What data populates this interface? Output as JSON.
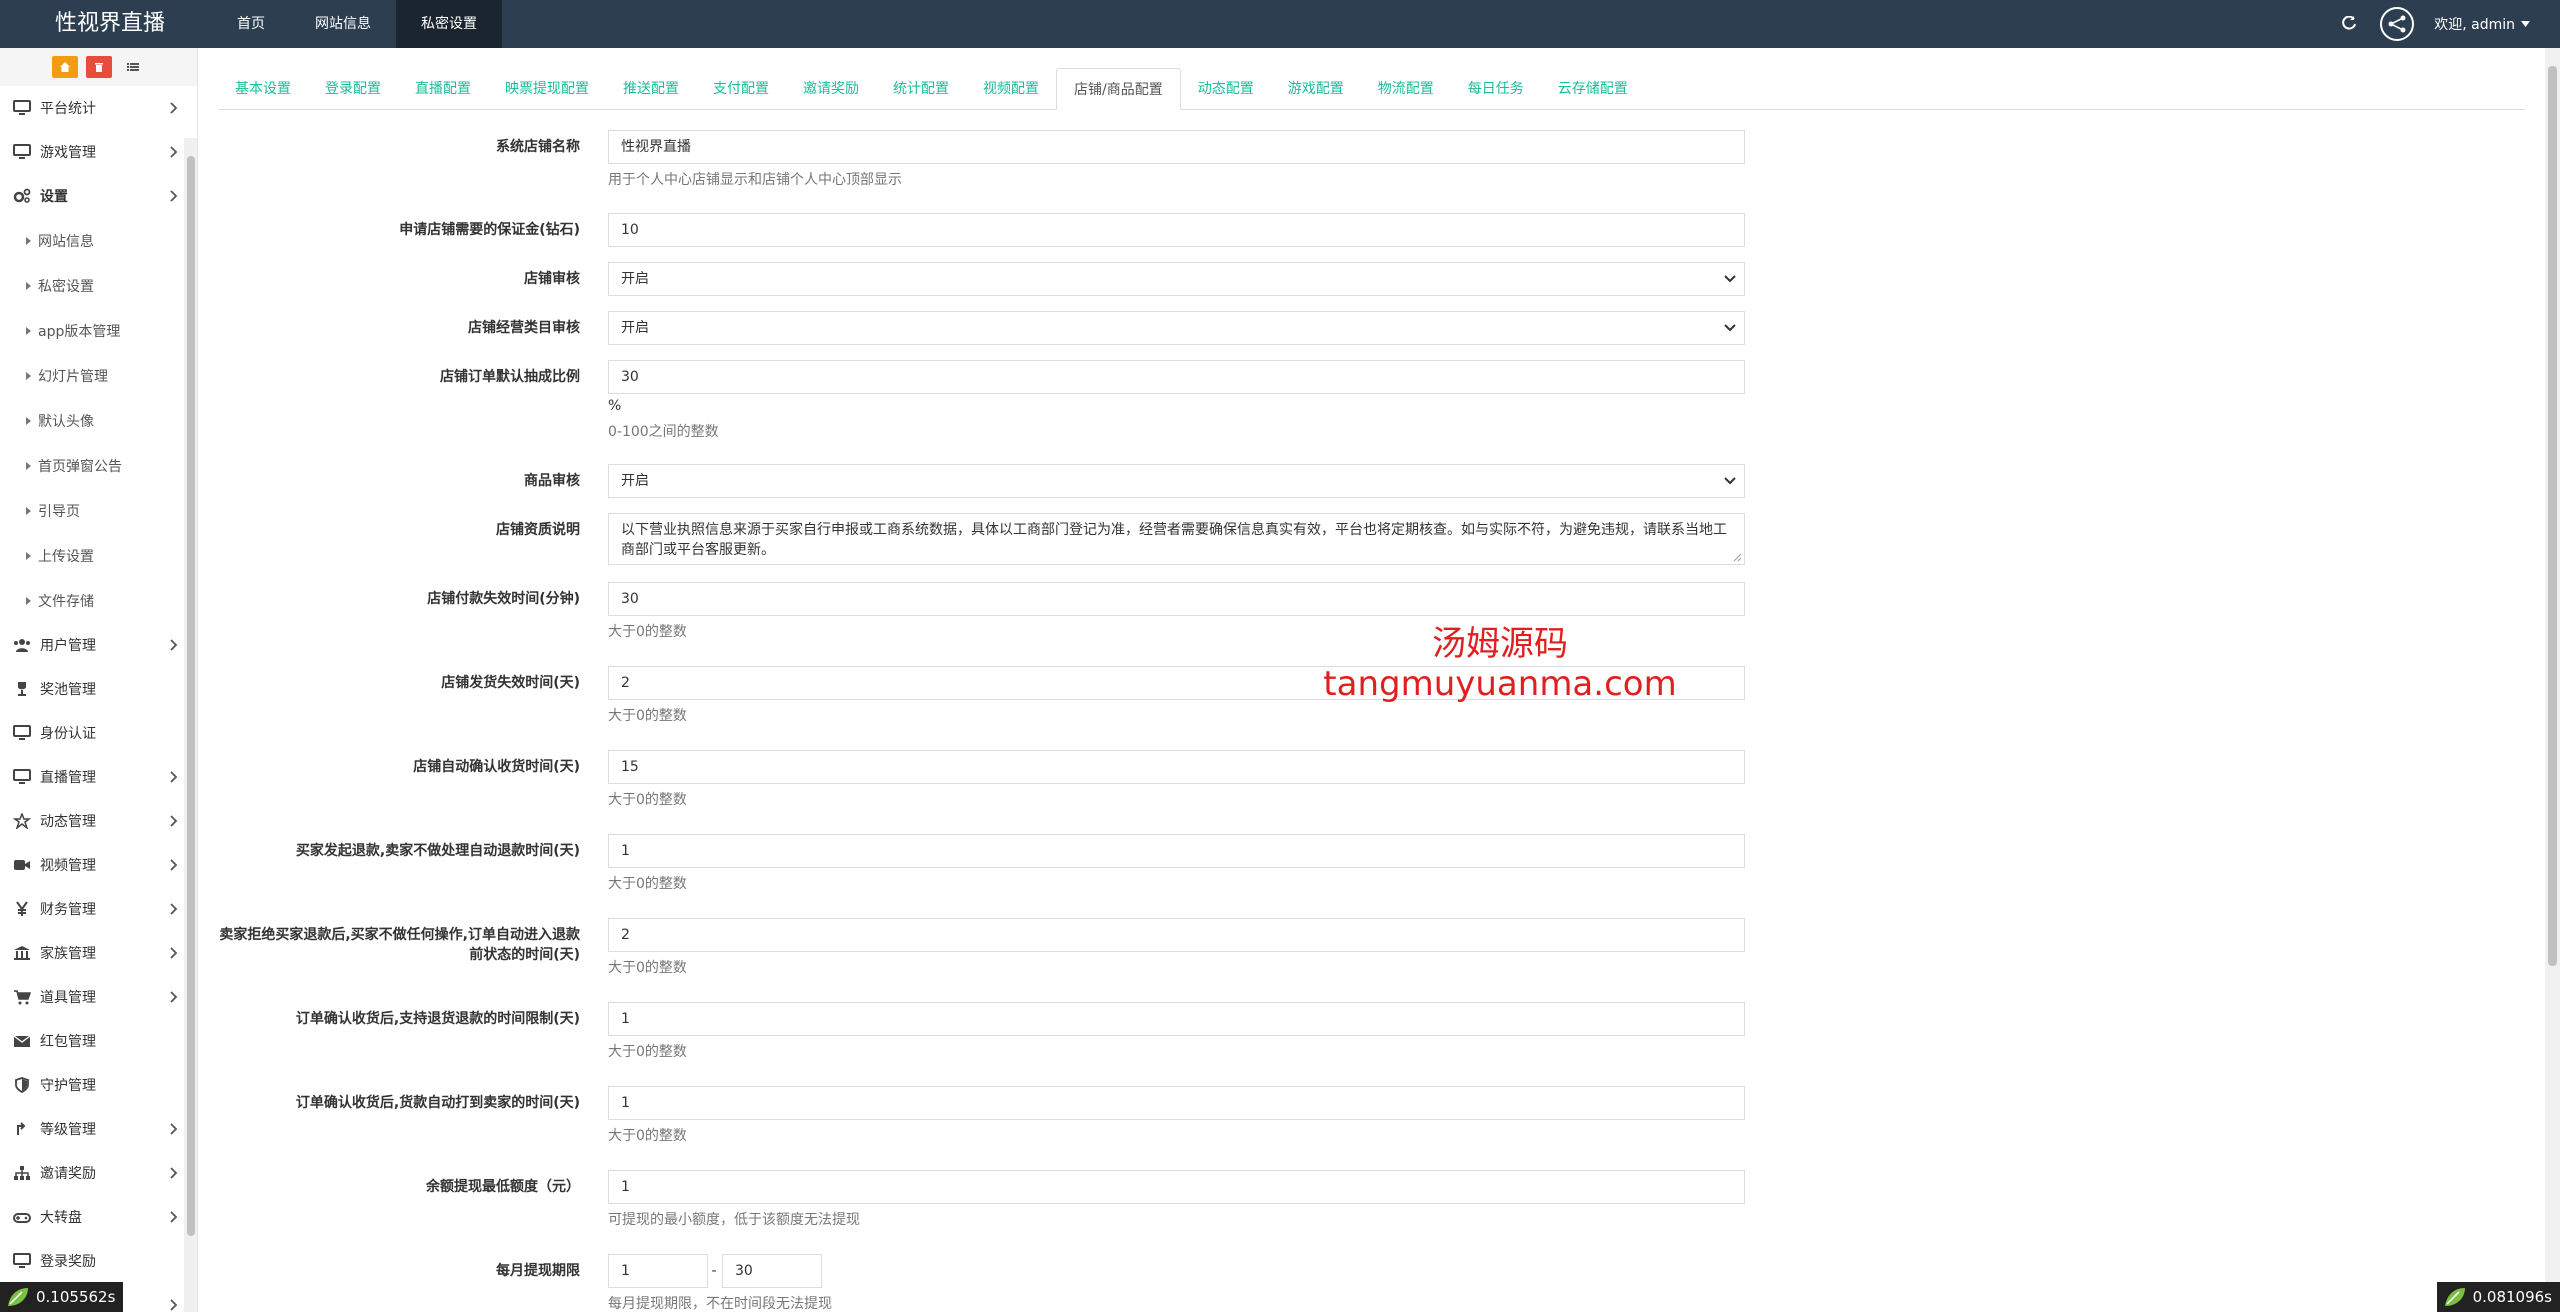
{
  "brand": "性视界直播",
  "topnav": [
    "首页",
    "网站信息",
    "私密设置"
  ],
  "user": "欢迎, admin",
  "sidebar": {
    "items_top": [
      {
        "label": "平台统计",
        "icon": "monitor-icon"
      },
      {
        "label": "游戏管理",
        "icon": "monitor-icon"
      },
      {
        "label": "设置",
        "icon": "gears-icon"
      }
    ],
    "sub": [
      "网站信息",
      "私密设置",
      "app版本管理",
      "幻灯片管理",
      "默认头像",
      "首页弹窗公告",
      "引导页",
      "上传设置",
      "文件存储"
    ],
    "items_bottom": [
      {
        "label": "用户管理",
        "icon": "users-icon",
        "chev": true
      },
      {
        "label": "奖池管理",
        "icon": "trophy-icon",
        "chev": false
      },
      {
        "label": "身份认证",
        "icon": "monitor-icon",
        "chev": false
      },
      {
        "label": "直播管理",
        "icon": "monitor-icon",
        "chev": true
      },
      {
        "label": "动态管理",
        "icon": "star-icon",
        "chev": true
      },
      {
        "label": "视频管理",
        "icon": "video-icon",
        "chev": true
      },
      {
        "label": "财务管理",
        "icon": "yen-icon",
        "chev": true
      },
      {
        "label": "家族管理",
        "icon": "bank-icon",
        "chev": true
      },
      {
        "label": "道具管理",
        "icon": "cart-icon",
        "chev": true
      },
      {
        "label": "红包管理",
        "icon": "envelope-icon",
        "chev": false
      },
      {
        "label": "守护管理",
        "icon": "shield-icon",
        "chev": false
      },
      {
        "label": "等级管理",
        "icon": "level-icon",
        "chev": true
      },
      {
        "label": "邀请奖励",
        "icon": "sitemap-icon",
        "chev": true
      },
      {
        "label": "大转盘",
        "icon": "gamepad-icon",
        "chev": true
      },
      {
        "label": "登录奖励",
        "icon": "monitor-icon",
        "chev": false
      },
      {
        "label": "",
        "icon": "monitor-icon",
        "chev": true
      }
    ]
  },
  "tabs": [
    "基本设置",
    "登录配置",
    "直播配置",
    "映票提现配置",
    "推送配置",
    "支付配置",
    "邀请奖励",
    "统计配置",
    "视频配置",
    "店铺/商品配置",
    "动态配置",
    "游戏配置",
    "物流配置",
    "每日任务",
    "云存储配置"
  ],
  "active_tab": "店铺/商品配置",
  "form": {
    "shop_name": {
      "label": "系统店铺名称",
      "value": "性视界直播",
      "help": "用于个人中心店铺显示和店铺个人中心顶部显示"
    },
    "deposit": {
      "label": "申请店铺需要的保证金(钻石)",
      "value": "10"
    },
    "shop_review": {
      "label": "店铺审核",
      "value": "开启"
    },
    "category_review": {
      "label": "店铺经营类目审核",
      "value": "开启"
    },
    "commission": {
      "label": "店铺订单默认抽成比例",
      "value": "30",
      "unit": "%",
      "help": "0-100之间的整数"
    },
    "goods_review": {
      "label": "商品审核",
      "value": "开启"
    },
    "qualification": {
      "label": "店铺资质说明",
      "value": "以下营业执照信息来源于买家自行申报或工商系统数据，具体以工商部门登记为准，经营者需要确保信息真实有效，平台也将定期核查。如与实际不符，为避免违规，请联系当地工商部门或平台客服更新。"
    },
    "pay_timeout": {
      "label": "店铺付款失效时间(分钟)",
      "value": "30",
      "help": "大于0的整数"
    },
    "ship_timeout": {
      "label": "店铺发货失效时间(天)",
      "value": "2",
      "help": "大于0的整数"
    },
    "auto_receive": {
      "label": "店铺自动确认收货时间(天)",
      "value": "15",
      "help": "大于0的整数"
    },
    "refund_auto": {
      "label": "买家发起退款,卖家不做处理自动退款时间(天)",
      "value": "1",
      "help": "大于0的整数"
    },
    "refuse_refund_1": {
      "label": "卖家拒绝买家退款后,买家不做任何操作,订单自动进入退款",
      "label2": "前状态的时间(天)",
      "value": "2",
      "help": "大于0的整数"
    },
    "return_limit": {
      "label": "订单确认收货后,支持退货退款的时间限制(天)",
      "value": "1",
      "help": "大于0的整数"
    },
    "settle_time": {
      "label": "订单确认收货后,货款自动打到卖家的时间(天)",
      "value": "1",
      "help": "大于0的整数"
    },
    "min_withdraw": {
      "label": "余额提现最低额度（元）",
      "value": "1",
      "help": "可提现的最小额度，低于该额度无法提现"
    },
    "withdraw_period": {
      "label": "每月提现期限",
      "from": "1",
      "sep": "-",
      "to": "30",
      "help": "每月提现期限，不在时间段无法提现"
    }
  },
  "watermark": {
    "line1": "汤姆源码",
    "line2": "tangmuyuanma.com"
  },
  "timers": {
    "left": "0.105562s",
    "right": "0.081096s"
  }
}
